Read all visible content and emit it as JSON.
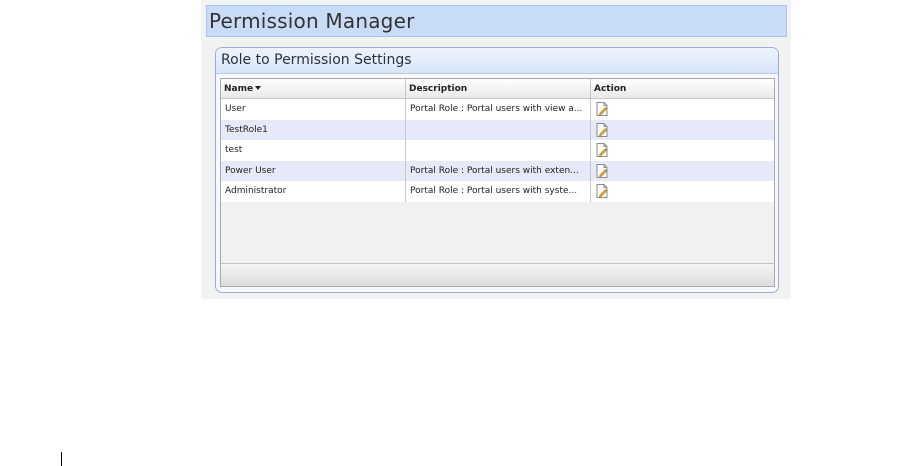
{
  "page": {
    "title": "Permission Manager"
  },
  "panel": {
    "title": "Role to Permission Settings"
  },
  "grid": {
    "columns": [
      {
        "label": "Name",
        "sorted": "descending"
      },
      {
        "label": "Description"
      },
      {
        "label": "Action"
      }
    ],
    "rows": [
      {
        "name": "User",
        "description": "Portal Role : Portal users with view a...",
        "action_icon": "edit-icon"
      },
      {
        "name": "TestRole1",
        "description": "",
        "action_icon": "edit-icon"
      },
      {
        "name": "test",
        "description": "",
        "action_icon": "edit-icon"
      },
      {
        "name": "Power User",
        "description": "Portal Role : Portal users with exten...",
        "action_icon": "edit-icon"
      },
      {
        "name": "Administrator",
        "description": "Portal Role : Portal users with syste...",
        "action_icon": "edit-icon"
      }
    ]
  },
  "colors": {
    "title_bar_bg": "#c8dcf8",
    "row_alt_bg": "#e6e9f7",
    "panel_border": "#98aed4"
  }
}
